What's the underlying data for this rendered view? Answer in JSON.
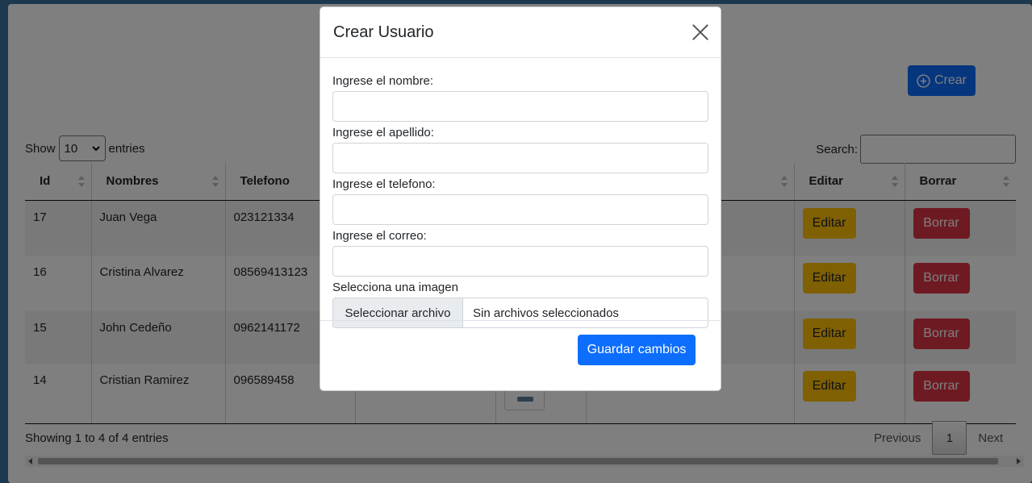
{
  "page": {
    "crear_label": "Crear",
    "show_label": "Show",
    "entries_label": "entries",
    "length_value": "10",
    "search_label": "Search:",
    "info": "Showing 1 to 4 of 4 entries",
    "pagination": {
      "previous": "Previous",
      "current": "1",
      "next": "Next"
    }
  },
  "table": {
    "headers": [
      "Id",
      "Nombres",
      "Telefono",
      "",
      "",
      "",
      "Editar",
      "Borrar"
    ],
    "edit_label": "Editar",
    "delete_label": "Borrar",
    "rows": [
      {
        "id": "17",
        "nombre": "Juan Vega",
        "telefono": "023121334"
      },
      {
        "id": "16",
        "nombre": "Cristina Alvarez",
        "telefono": "08569413123"
      },
      {
        "id": "15",
        "nombre": "John Cedeño",
        "telefono": "0962141172"
      },
      {
        "id": "14",
        "nombre": "Cristian Ramirez",
        "telefono": "096589458"
      }
    ]
  },
  "modal": {
    "title": "Crear Usuario",
    "fields": {
      "nombre": {
        "label": "Ingrese el nombre:",
        "value": ""
      },
      "apellido": {
        "label": "Ingrese el apellido:",
        "value": ""
      },
      "telefono": {
        "label": "Ingrese el telefono:",
        "value": ""
      },
      "correo": {
        "label": "Ingrese el correo:",
        "value": ""
      }
    },
    "image_label": "Selecciona una imagen",
    "file_button": "Seleccionar archivo",
    "file_status": "Sin archivos seleccionados",
    "save_label": "Guardar cambios"
  },
  "colors": {
    "primary": "#0d6efd",
    "warning": "#ffc107",
    "danger": "#dc3545",
    "frame": "#3a6f9a"
  }
}
